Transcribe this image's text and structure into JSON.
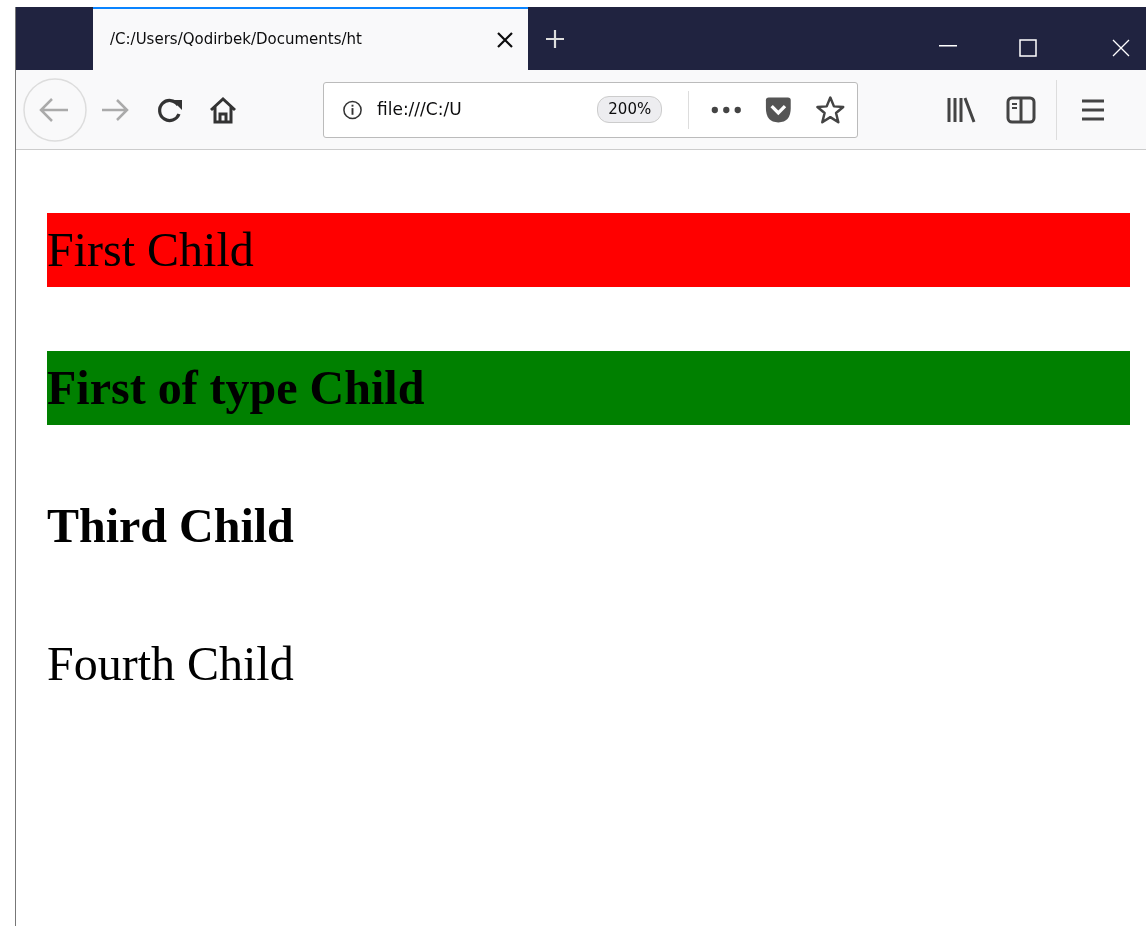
{
  "tab": {
    "title": "/C:/Users/Qodirbek/Documents/ht",
    "selected": true
  },
  "address_bar": {
    "url": "file:///C:/U",
    "zoom": "200%"
  },
  "paragraphs": [
    {
      "text": "First Child",
      "bold": false,
      "color": "#ff0000"
    },
    {
      "text": "First of type Child",
      "bold": true,
      "color": "#008000"
    },
    {
      "text": "Third Child",
      "bold": true
    },
    {
      "text": "Fourth Child",
      "bold": false
    }
  ]
}
